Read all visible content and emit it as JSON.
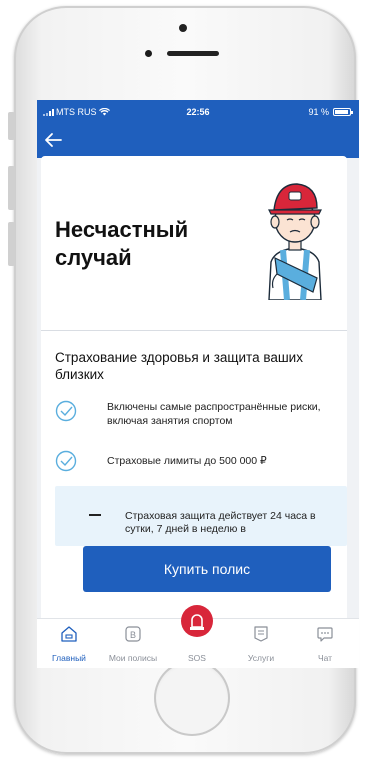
{
  "status_bar": {
    "carrier": "MTS RUS",
    "time": "22:56",
    "battery": "91 %",
    "battery_level": 0.91
  },
  "header": {
    "back_icon": "arrow-left-icon"
  },
  "page": {
    "title": "Несчастный случай",
    "subtitle": "Страхование здоровья и защита ваших близких",
    "features": [
      {
        "icon": "check-circle-icon",
        "text": "Включены самые распространённые риски, включая занятия спортом"
      },
      {
        "icon": "check-circle-icon",
        "text": "Страховые лимиты до 500 000 ₽"
      }
    ],
    "info_text": "Страховая защита действует 24 часа в сутки, 7 дней в неделю в",
    "buy_button": "Купить полис"
  },
  "tabs": [
    {
      "label": "Главный",
      "icon": "home-icon",
      "active": true
    },
    {
      "label": "Мои полисы",
      "icon": "policy-icon",
      "active": false
    },
    {
      "label": "SOS",
      "icon": "alarm-icon",
      "active": false
    },
    {
      "label": "Услуги",
      "icon": "services-icon",
      "active": false
    },
    {
      "label": "Чат",
      "icon": "chat-icon",
      "active": false
    }
  ],
  "colors": {
    "brand": "#1f5fbd",
    "sos": "#d8263a",
    "accent_check": "#5aaede",
    "info_bg": "#e8f3fb"
  }
}
